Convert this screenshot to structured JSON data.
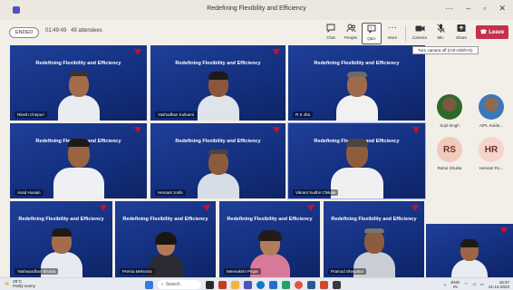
{
  "window": {
    "title": "Redefining Flexibility and Efficiency"
  },
  "toolbar": {
    "status_badge": "ENDED",
    "elapsed": "01:49:49",
    "attendees": "49 attendees",
    "buttons": [
      {
        "label": "Chat",
        "icon": "chat-icon"
      },
      {
        "label": "People",
        "icon": "people-icon"
      },
      {
        "label": "Q&A",
        "icon": "qna-icon"
      },
      {
        "label": "More",
        "icon": "more-icon"
      },
      {
        "label": "Camera",
        "icon": "camera-icon"
      },
      {
        "label": "Mic",
        "icon": "mic-icon"
      },
      {
        "label": "Share",
        "icon": "share-icon"
      }
    ],
    "leave_label": "Leave",
    "tooltip": "Turn camera off (Ctrl+Shift+O)"
  },
  "slide_title": "Redefining Flexibility and Efficiency",
  "participants": [
    "Ritesh Chepuri",
    "Yashodhan Kulkarni",
    "R S Jha",
    "Asad Husain",
    "Hemant Joshi",
    "Vikrant Sudhir Chikale",
    "Yashwardhan Shukla",
    "Prerna Mehrotra",
    "Meenakshi Pegar",
    "Pramod Shegokar"
  ],
  "side_participants": [
    {
      "name": "Sujit Singh",
      "initials": ""
    },
    {
      "name": "AIPL Kulde...",
      "initials": ""
    },
    {
      "name": "Rahul Shukla",
      "initials": "RS"
    },
    {
      "name": "Hemant Ro...",
      "initials": "HR"
    }
  ],
  "taskbar": {
    "weather_temp": "28°C",
    "weather_desc": "Partly sunny",
    "search_label": "Search",
    "lang": "ENG",
    "lang2": "IN",
    "time": "16:37",
    "date": "21-12-2023"
  }
}
